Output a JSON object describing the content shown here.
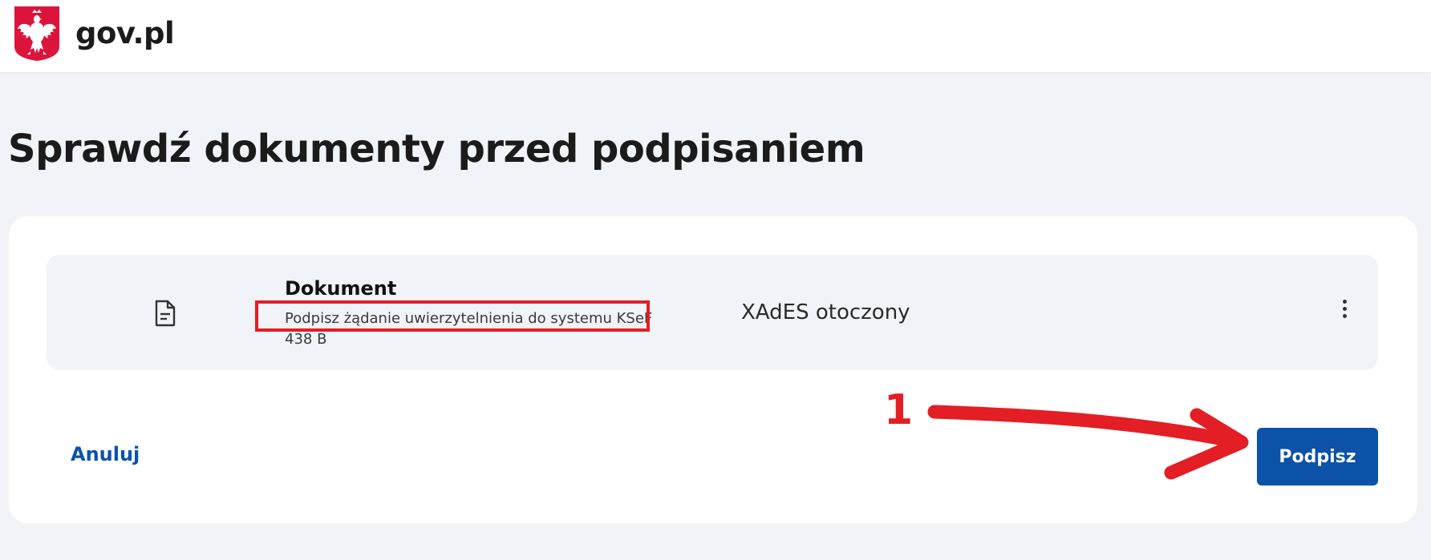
{
  "header": {
    "brand": "gov.pl",
    "emblem_icon": "polish-eagle-emblem-icon",
    "emblem_color": "#dc143c"
  },
  "page": {
    "title": "Sprawdź dokumenty przed podpisaniem"
  },
  "document": {
    "icon": "document-icon",
    "name": "Dokument",
    "description": "Podpisz żądanie uwierzytelnienia do systemu KSeF",
    "size": "438 B",
    "format": "XAdES otoczony",
    "menu_icon": "more-vertical-icon"
  },
  "actions": {
    "cancel_label": "Anuluj",
    "sign_label": "Podpisz"
  },
  "annotations": {
    "step_number": "1",
    "highlight_color": "#e31e24"
  },
  "colors": {
    "primary": "#0b52a8",
    "background": "#f0f4f8",
    "card": "#ffffff",
    "annotation": "#e31e24"
  }
}
